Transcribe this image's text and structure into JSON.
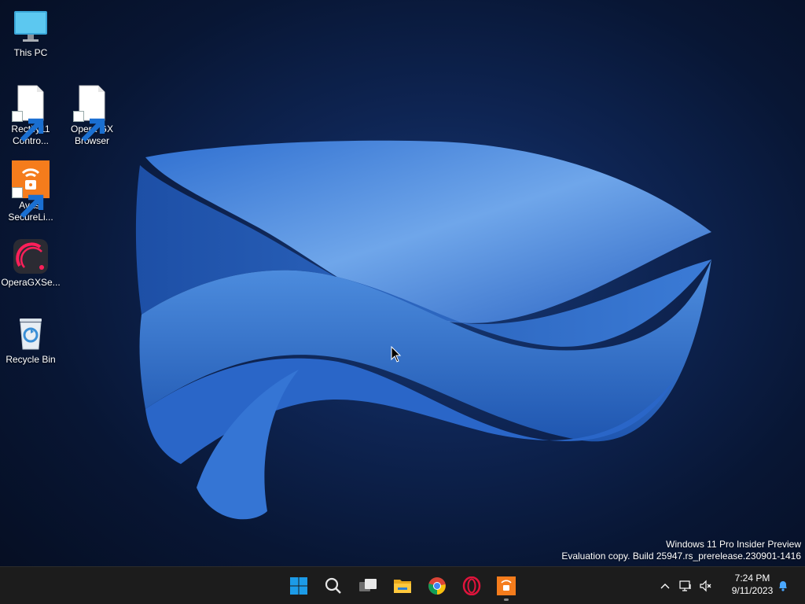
{
  "desktop": {
    "icons": [
      {
        "label": "This PC"
      },
      {
        "label": "Rectify11 Contro..."
      },
      {
        "label": "Opera GX Browser"
      },
      {
        "label": "Avast SecureLi..."
      },
      {
        "label": "OperaGXSe..."
      },
      {
        "label": "Recycle Bin"
      }
    ]
  },
  "watermark": {
    "line1": "Windows 11 Pro Insider Preview",
    "line2": "Evaluation copy. Build 25947.rs_prerelease.230901-1416"
  },
  "taskbar": {
    "apps": [
      {
        "icon": "windows-start-icon"
      },
      {
        "icon": "search-icon"
      },
      {
        "icon": "task-view-icon"
      },
      {
        "icon": "file-explorer-icon"
      },
      {
        "icon": "chrome-icon"
      },
      {
        "icon": "opera-gx-icon"
      },
      {
        "icon": "avast-secureline-icon"
      }
    ],
    "tray": {
      "icons": [
        "chevron-up-icon",
        "network-icon",
        "volume-muted-icon",
        "notification-bell-icon"
      ],
      "time": "7:24 PM",
      "date": "9/11/2023"
    }
  },
  "colors": {
    "taskbar_bg": "#1c1c1c",
    "wallpaper_bloom": "#3f7fd6",
    "avast_orange": "#f57c1c",
    "start_blue": "#1c9be8"
  }
}
